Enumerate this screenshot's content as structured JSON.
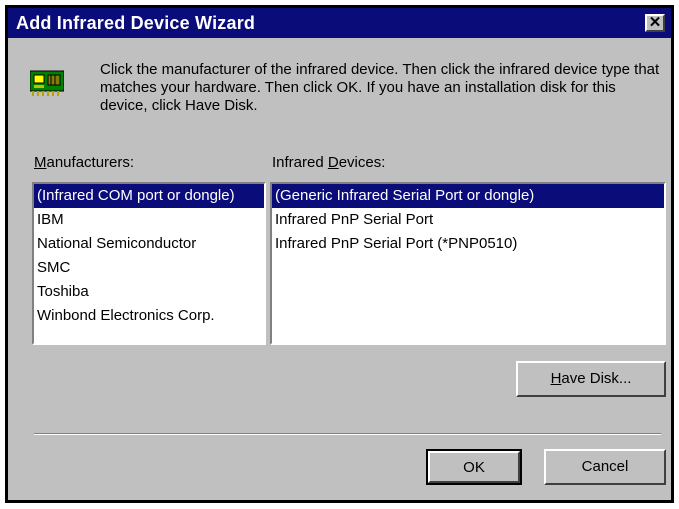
{
  "window": {
    "title": "Add Infrared Device Wizard",
    "close_glyph": "✕"
  },
  "instructions": "Click the manufacturer of the infrared device.  Then click the infrared device type that matches your hardware.  Then click OK.  If you have an installation disk for this device, click Have Disk.",
  "manufacturers": {
    "label": "Manufacturers:",
    "items": [
      "(Infrared COM port or dongle)",
      "IBM",
      "National Semiconductor",
      "SMC",
      "Toshiba",
      "Winbond Electronics Corp."
    ],
    "selected": "(Infrared COM port or dongle)"
  },
  "devices": {
    "label": "Infrared Devices:",
    "items": [
      "(Generic Infrared Serial Port or dongle)",
      "Infrared PnP Serial Port",
      "Infrared PnP Serial Port (*PNP0510)"
    ],
    "selected": "(Generic Infrared Serial Port or dongle)"
  },
  "buttons": {
    "have_disk": "Have Disk...",
    "ok": "OK",
    "cancel": "Cancel"
  },
  "icons": {
    "device": "circuit-board-icon",
    "close": "close-icon"
  },
  "colors": {
    "titlebar": "#0a0c7a",
    "selection": "#0a0c7a",
    "face": "#c0c0c0"
  }
}
